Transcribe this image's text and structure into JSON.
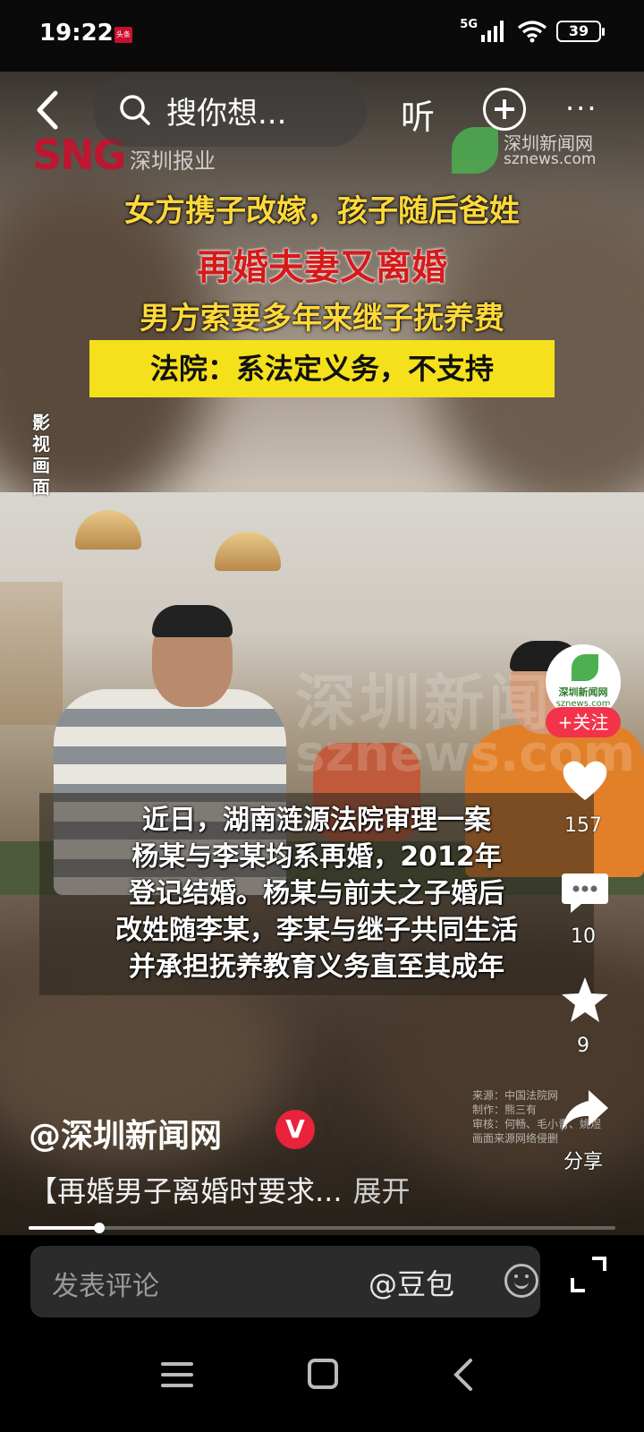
{
  "status": {
    "time": "19:22",
    "notif_label": "头条",
    "network": "5G",
    "battery": "39"
  },
  "header": {
    "search_text": "搜你想...",
    "listen_label": "听",
    "more_label": "···"
  },
  "video": {
    "logo_left": "SNG",
    "logo_left_sub": "深圳报业",
    "logo_right_cn": "深圳新闻网",
    "logo_right_en": "sznews.com",
    "headline_1": "女方携子改嫁，孩子随后爸姓",
    "headline_2": "再婚夫妻又离婚",
    "headline_3": "男方索要多年来继子抚养费",
    "headline_4": "法院：系法定义务，不支持",
    "side_tag": "影视画面",
    "watermark_cn": "深圳新闻网",
    "watermark_en": "sznews.com",
    "subtitles": [
      "近日，湖南涟源法院审理一案",
      "杨某与李某均系再婚，2012年",
      "登记结婚。杨某与前夫之子婚后",
      "改姓随李某，李某与继子共同生活",
      "并承担抚养教育义务直至其成年"
    ],
    "credits": [
      "来源：中国法院网",
      "制作：熊三有",
      "审核：何畅、毛小青、姚煜",
      "画面来源网络侵删"
    ]
  },
  "rail": {
    "avatar_cn": "深圳新闻网",
    "avatar_en": "sznews.com",
    "follow_label": "+关注",
    "like_count": "157",
    "comment_count": "10",
    "favorite_count": "9",
    "share_label": "分享"
  },
  "post": {
    "author": "@深圳新闻网",
    "verified_badge": "V",
    "description": "【再婚男子离婚时要求...",
    "expand_label": "展开",
    "progress": 0.12
  },
  "comment": {
    "placeholder": "发表评论",
    "doubao_label": "@豆包"
  },
  "colors": {
    "accent_red": "#f2334a",
    "headline_yellow": "#ffd83a",
    "headline_red": "#d61a1a",
    "banner_yellow": "#f5e11b"
  }
}
